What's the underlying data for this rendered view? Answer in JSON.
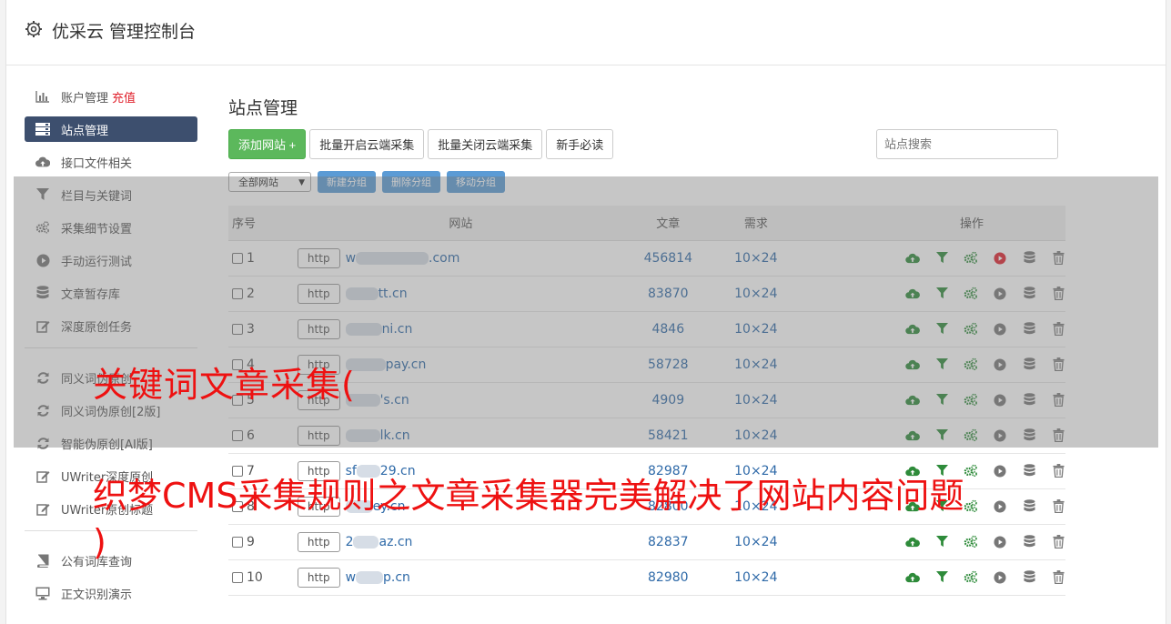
{
  "header": {
    "title": "优采云 管理控制台"
  },
  "sidebar": {
    "items": [
      {
        "label": "账户管理",
        "badge": "充值",
        "icon": "bar-chart-icon"
      },
      {
        "label": "站点管理",
        "icon": "server-icon",
        "active": true
      },
      {
        "label": "接口文件相关",
        "icon": "cloud-upload-icon"
      },
      {
        "label": "栏目与关键词",
        "icon": "filter-icon"
      },
      {
        "label": "采集细节设置",
        "icon": "cogs-icon"
      },
      {
        "label": "手动运行测试",
        "icon": "play-icon"
      },
      {
        "label": "文章暂存库",
        "icon": "database-icon"
      },
      {
        "label": "深度原创任务",
        "icon": "edit-icon"
      }
    ],
    "items2": [
      {
        "label": "同义词伪原创",
        "icon": "refresh-icon"
      },
      {
        "label": "同义词伪原创[2版]",
        "icon": "refresh-icon"
      },
      {
        "label": "智能伪原创[AI版]",
        "icon": "refresh-icon"
      },
      {
        "label": "UWriter深度原创",
        "icon": "edit-icon"
      },
      {
        "label": "UWriter原创标题",
        "icon": "edit-icon"
      }
    ],
    "items3": [
      {
        "label": "公有词库查询",
        "icon": "book-icon"
      },
      {
        "label": "正文识别演示",
        "icon": "monitor-icon"
      }
    ]
  },
  "main": {
    "title": "站点管理",
    "toolbar": {
      "add": "添加网站 +",
      "enable": "批量开启云端采集",
      "disable": "批量关闭云端采集",
      "guide": "新手必读"
    },
    "search_placeholder": "站点搜索",
    "group_select": "全部网站",
    "group_buttons": {
      "new": "新建分组",
      "delete": "删除分组",
      "move": "移动分组"
    },
    "table": {
      "headers": {
        "no": "序号",
        "site": "网站",
        "articles": "文章",
        "demand": "需求",
        "ops": "操作"
      },
      "rows": [
        {
          "no": "1",
          "prefix": "w",
          "suffix": ".com",
          "articles": "456814",
          "demand": "10×24",
          "running": true
        },
        {
          "no": "2",
          "prefix": "",
          "suffix": "tt.cn",
          "articles": "83870",
          "demand": "10×24",
          "running": false
        },
        {
          "no": "3",
          "prefix": "",
          "suffix": "ni.cn",
          "articles": "4846",
          "demand": "10×24",
          "running": false
        },
        {
          "no": "4",
          "prefix": "",
          "suffix": "pay.cn",
          "articles": "58728",
          "demand": "10×24",
          "running": false
        },
        {
          "no": "5",
          "prefix": "",
          "suffix": "'s.cn",
          "articles": "4909",
          "demand": "10×24",
          "running": false
        },
        {
          "no": "6",
          "prefix": "",
          "suffix": "lk.cn",
          "articles": "58421",
          "demand": "10×24",
          "running": false
        },
        {
          "no": "7",
          "prefix": "sf",
          "suffix": "29.cn",
          "articles": "82987",
          "demand": "10×24",
          "running": false
        },
        {
          "no": "8",
          "prefix": "",
          "suffix": "ey.cn",
          "articles": "82800",
          "demand": "10×24",
          "running": false
        },
        {
          "no": "9",
          "prefix": "2",
          "suffix": "az.cn",
          "articles": "82837",
          "demand": "10×24",
          "running": false
        },
        {
          "no": "10",
          "prefix": "w",
          "suffix": "p.cn",
          "articles": "82980",
          "demand": "10×24",
          "running": false
        }
      ],
      "http_label": "http"
    }
  },
  "watermark": {
    "line1": "关键词文章采集(",
    "line2": "织梦CMS采集规则之文章采集器完美解决了网站内容问题",
    "line3": ")"
  },
  "colors": {
    "accent": "#3d4f6e",
    "green": "#5cb85c",
    "link": "#2f6aa8",
    "red": "#e0202b"
  }
}
